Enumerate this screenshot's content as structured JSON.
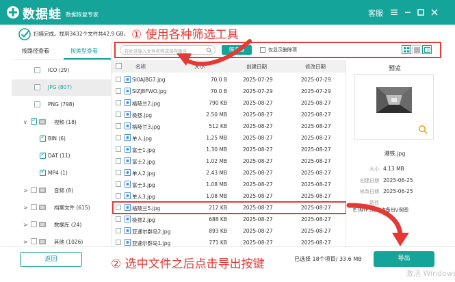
{
  "app": {
    "title": "数据蛙",
    "subtitle": "数据恢复专家",
    "service_label": "客服"
  },
  "status": {
    "text": "扫描完成。找到3432个文件共42.9 GB。"
  },
  "annotations": {
    "step1": "① 使用各种筛选工具",
    "step2": "② 选中文件之后点击导出按键"
  },
  "tabs": {
    "by_path": "按路径查看",
    "by_type": "按类型查看"
  },
  "tree": [
    {
      "label": "ICO (29)",
      "checked": false,
      "expander": ""
    },
    {
      "label": "JPG (807)",
      "checked": false,
      "expander": ""
    },
    {
      "label": "PNG (798)",
      "checked": false,
      "expander": ""
    },
    {
      "label": "视频 (18)",
      "checked": true,
      "expander": "∨"
    },
    {
      "label": "BIN (6)",
      "checked": true,
      "expander": ""
    },
    {
      "label": "DAT (11)",
      "checked": true,
      "expander": ""
    },
    {
      "label": "MP4 (1)",
      "checked": true,
      "expander": ""
    },
    {
      "label": "音频 (8)",
      "checked": false,
      "expander": ">"
    },
    {
      "label": "档案文件 (615)",
      "checked": false,
      "expander": ">"
    },
    {
      "label": "数据库 (24)",
      "checked": false,
      "expander": ">"
    },
    {
      "label": "其他 (1026)",
      "checked": false,
      "expander": ">"
    }
  ],
  "toolbar": {
    "search_placeholder": "在此处输入文件名称或保存路径",
    "filter_label": "筛选器",
    "deleted_only_label": "仅显示删除项"
  },
  "list": {
    "headers": {
      "name": "名称",
      "size": "大小",
      "created": "创建日期",
      "modified": "修改日期"
    },
    "rows": [
      {
        "name": "SI0AJBG7.jpg",
        "size": "70.0  B",
        "created": "2025-07-29",
        "modified": "2025-07-29"
      },
      {
        "name": "SIZJ8FWO.jpg",
        "size": "70.0  B",
        "created": "2025-07-29",
        "modified": "2025-07-29"
      },
      {
        "name": "格陵兰2.jpg",
        "size": "790 KB",
        "created": "2025-08-27",
        "modified": "2025-08-27"
      },
      {
        "name": "极昼.jpg",
        "size": "2.50 MB",
        "created": "2025-08-27",
        "modified": "2025-08-27"
      },
      {
        "name": "格陵兰3.jpg",
        "size": "512 KB",
        "created": "2025-08-27",
        "modified": "2025-08-27"
      },
      {
        "name": "单人.jpg",
        "size": "1.25 MB",
        "created": "2025-08-27",
        "modified": "2025-08-27"
      },
      {
        "name": "富士1.jpg",
        "size": "1.30 MB",
        "created": "2025-08-27",
        "modified": "2025-08-27"
      },
      {
        "name": "富士2.jpg",
        "size": "1.02 MB",
        "created": "2025-08-27",
        "modified": "2025-08-27"
      },
      {
        "name": "单人2.jpg",
        "size": "2.43 MB",
        "created": "2025-08-27",
        "modified": "2025-08-27"
      },
      {
        "name": "富士3.jpg",
        "size": "1.08 MB",
        "created": "2025-08-27",
        "modified": "2025-08-27"
      },
      {
        "name": "单人3.jpg",
        "size": "1.08 MB",
        "created": "2025-08-27",
        "modified": "2025-08-27"
      },
      {
        "name": "格陵兰5.jpg",
        "size": "212 KB",
        "created": "2025-08-27",
        "modified": "2025-08-27"
      },
      {
        "name": "极昼2.jpg",
        "size": "688 KB",
        "created": "2025-08-27",
        "modified": "2025-08-27"
      },
      {
        "name": "亚速尔群岛2.jpg",
        "size": "893 KB",
        "created": "2025-08-27",
        "modified": "2025-08-27"
      },
      {
        "name": "亚速尔群岛1.jpg",
        "size": "771 KB",
        "created": "2025-08-27",
        "modified": "2025-08-27"
      }
    ]
  },
  "preview": {
    "title": "预览",
    "file_name": "港铁.jpg",
    "size_label": "大小",
    "size_value": "4.13 MB",
    "created_label": "创建日期",
    "created_value": "2025-06-25",
    "modified_label": "修改日期",
    "modified_value": "2025-06-25",
    "path_label": "路径",
    "path_value": "E:\\NTFS\\1工作备份\\(例图"
  },
  "bottom": {
    "back_label": "返回",
    "selected_info": "已选择 18个项目/ 33.6 MB",
    "export_label": "导出",
    "watermark": "激活 Windows"
  },
  "colors": {
    "brand": "#15a49a",
    "annotation_red": "#e53935"
  }
}
